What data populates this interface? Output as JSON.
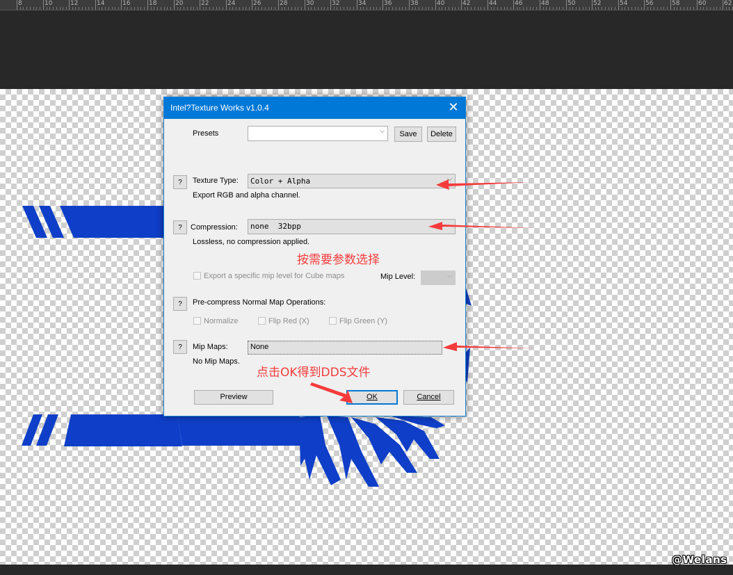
{
  "ruler": {
    "labels": [
      "8",
      "10",
      "12",
      "14",
      "16",
      "18",
      "20",
      "22",
      "24",
      "26",
      "28",
      "30",
      "32",
      "34",
      "36",
      "38",
      "40",
      "42",
      "44",
      "46",
      "48",
      "50",
      "52",
      "54",
      "56",
      "58",
      "60",
      "62"
    ]
  },
  "dialog": {
    "title": "Intel?Texture Works v1.0.4",
    "close_glyph": "✕",
    "presets": {
      "label": "Presets",
      "value": "",
      "save_label": "Save",
      "delete_label": "Delete"
    },
    "texture_type": {
      "help": "?",
      "label": "Texture Type:",
      "value": "Color + Alpha",
      "description": "Export RGB and alpha channel."
    },
    "compression": {
      "help": "?",
      "label": "Compression:",
      "value": "none  32bpp",
      "description": "Lossless, no compression applied."
    },
    "cube_export": {
      "label": "Export a specific mip level for Cube maps",
      "checked": false,
      "mip_level_label": "Mip Level:",
      "mip_level_value": ""
    },
    "normal_map": {
      "help": "?",
      "label": "Pre-compress Normal Map Operations:",
      "normalize_label": "Normalize",
      "flip_red_label": "Flip Red (X)",
      "flip_green_label": "Flip Green (Y)"
    },
    "mip_maps": {
      "help": "?",
      "label": "Mip Maps:",
      "value": "None",
      "description": "No Mip Maps."
    },
    "buttons": {
      "preview": "Preview",
      "ok": "OK",
      "cancel": "Cancel"
    }
  },
  "annotations": {
    "select_params": "按需要参数选择",
    "click_ok": "点击OK得到DDS文件"
  },
  "watermark": "@Welans",
  "colors": {
    "accent": "#0078d7",
    "artwork": "#0f3fc8",
    "annotation": "#f43b3b"
  }
}
